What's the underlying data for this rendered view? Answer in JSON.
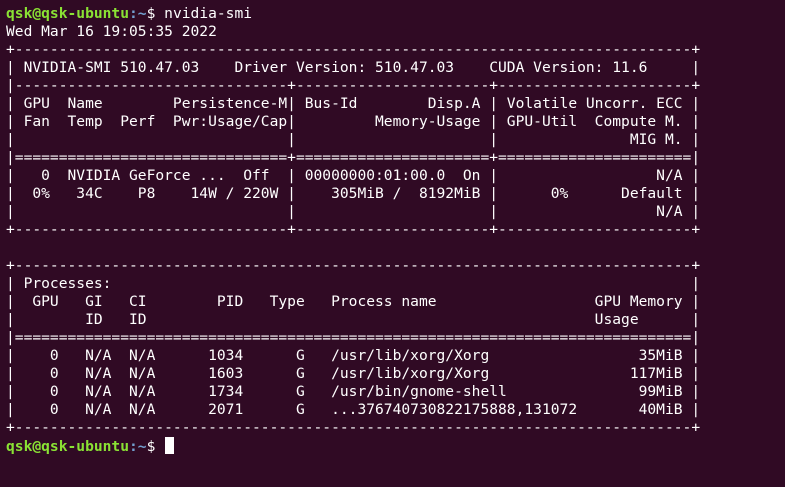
{
  "terminal": {
    "colors": {
      "background": "#300a24",
      "prompt_user": "#8ae234",
      "prompt_path": "#729fcf",
      "text": "#ffffff"
    },
    "prompt1": {
      "user_host": "qsk@qsk-ubuntu",
      "path": ":~",
      "symbol": "$ ",
      "command": "nvidia-smi"
    },
    "output_lines": [
      "Wed Mar 16 19:05:35 2022",
      "+-----------------------------------------------------------------------------+",
      "| NVIDIA-SMI 510.47.03    Driver Version: 510.47.03    CUDA Version: 11.6     |",
      "|-------------------------------+----------------------+----------------------+",
      "| GPU  Name        Persistence-M| Bus-Id        Disp.A | Volatile Uncorr. ECC |",
      "| Fan  Temp  Perf  Pwr:Usage/Cap|         Memory-Usage | GPU-Util  Compute M. |",
      "|                               |                      |               MIG M. |",
      "|===============================+======================+======================|",
      "|   0  NVIDIA GeForce ...  Off  | 00000000:01:00.0  On |                  N/A |",
      "|  0%   34C    P8    14W / 220W |    305MiB /  8192MiB |      0%      Default |",
      "|                               |                      |                  N/A |",
      "+-------------------------------+----------------------+----------------------+",
      "",
      "+-----------------------------------------------------------------------------+",
      "| Processes:                                                                  |",
      "|  GPU   GI   CI        PID   Type   Process name                  GPU Memory |",
      "|        ID   ID                                                   Usage      |",
      "|=============================================================================|",
      "|    0   N/A  N/A      1034      G   /usr/lib/xorg/Xorg                 35MiB |",
      "|    0   N/A  N/A      1603      G   /usr/lib/xorg/Xorg                117MiB |",
      "|    0   N/A  N/A      1734      G   /usr/bin/gnome-shell               99MiB |",
      "|    0   N/A  N/A      2071      G   ...376740730822175888,131072       40MiB |",
      "+-----------------------------------------------------------------------------+"
    ],
    "prompt2": {
      "user_host": "qsk@qsk-ubuntu",
      "path": ":~",
      "symbol": "$ "
    }
  }
}
